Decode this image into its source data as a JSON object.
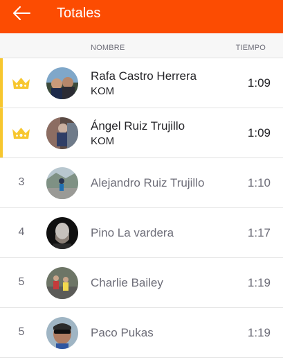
{
  "header": {
    "title": "Totales",
    "accent_color": "#fc4c02",
    "back_icon": "back-arrow-icon"
  },
  "columns": {
    "name": "NOMBRE",
    "time": "TIEMPO"
  },
  "kom_color": "#f7c72f",
  "entries": [
    {
      "rank": "",
      "is_kom": true,
      "name": "Rafa Castro Herrera",
      "badge": "KOM",
      "time": "1:09",
      "icon": "crown-icon"
    },
    {
      "rank": "",
      "is_kom": true,
      "name": "Ángel Ruiz Trujillo",
      "badge": "KOM",
      "time": "1:09",
      "icon": "crown-icon"
    },
    {
      "rank": "3",
      "is_kom": false,
      "name": "Alejandro Ruiz Trujillo",
      "badge": "",
      "time": "1:10"
    },
    {
      "rank": "4",
      "is_kom": false,
      "name": "Pino La vardera",
      "badge": "",
      "time": "1:17"
    },
    {
      "rank": "5",
      "is_kom": false,
      "name": "Charlie Bailey",
      "badge": "",
      "time": "1:19"
    },
    {
      "rank": "5",
      "is_kom": false,
      "name": "Paco Pukas",
      "badge": "",
      "time": "1:19"
    }
  ]
}
